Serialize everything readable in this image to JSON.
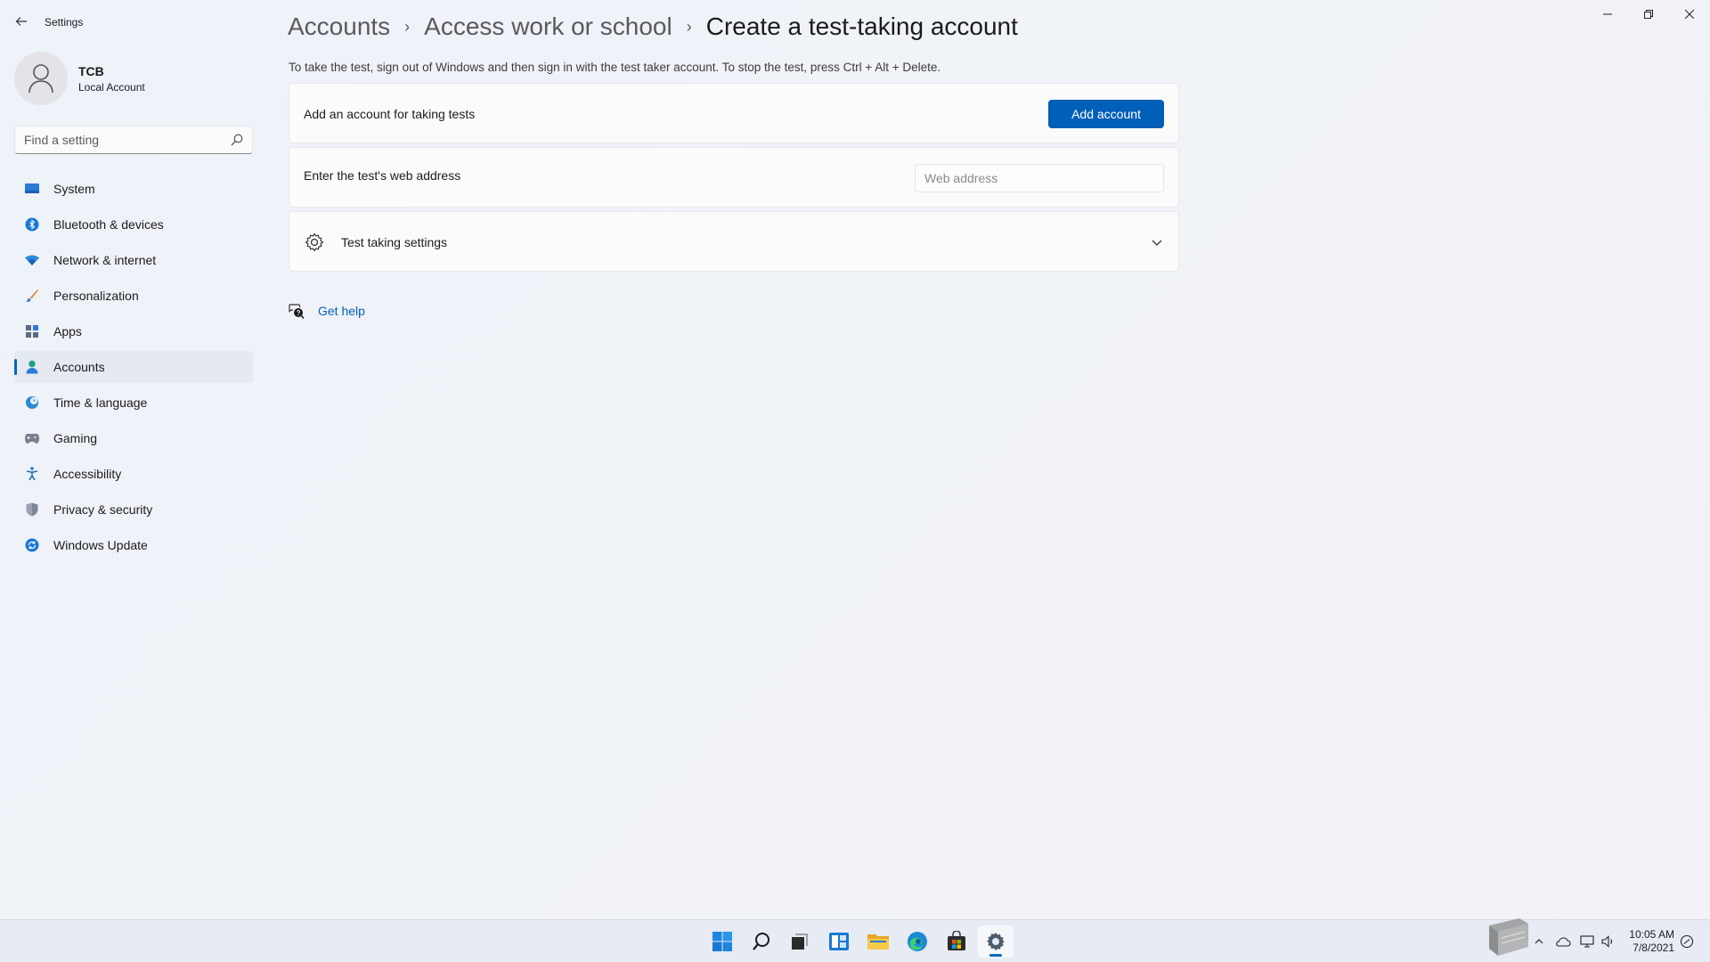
{
  "app": {
    "title": "Settings",
    "window_controls": {
      "minimize": "—",
      "maximize": "❐",
      "close": "✕"
    }
  },
  "profile": {
    "name": "TCB",
    "account_type": "Local Account"
  },
  "search": {
    "placeholder": "Find a setting"
  },
  "sidebar": {
    "items": [
      {
        "label": "System",
        "icon": "monitor-icon"
      },
      {
        "label": "Bluetooth & devices",
        "icon": "bluetooth-icon"
      },
      {
        "label": "Network & internet",
        "icon": "wifi-icon"
      },
      {
        "label": "Personalization",
        "icon": "brush-icon"
      },
      {
        "label": "Apps",
        "icon": "apps-icon"
      },
      {
        "label": "Accounts",
        "icon": "person-icon",
        "active": true
      },
      {
        "label": "Time & language",
        "icon": "globe-clock-icon"
      },
      {
        "label": "Gaming",
        "icon": "gamepad-icon"
      },
      {
        "label": "Accessibility",
        "icon": "accessibility-icon"
      },
      {
        "label": "Privacy & security",
        "icon": "shield-icon"
      },
      {
        "label": "Windows Update",
        "icon": "update-icon"
      }
    ]
  },
  "breadcrumb": {
    "items": [
      "Accounts",
      "Access work or school"
    ],
    "current": "Create a test-taking account",
    "separator": "›"
  },
  "main": {
    "description": "To take the test, sign out of Windows and then sign in with the test taker account. To stop the test, press Ctrl + Alt + Delete.",
    "add_account_card": {
      "label": "Add an account for taking tests",
      "button_label": "Add account"
    },
    "web_address_card": {
      "label": "Enter the test's web address",
      "input_placeholder": "Web address",
      "input_value": ""
    },
    "settings_card": {
      "label": "Test taking settings",
      "icon": "gear-icon",
      "expanded": false
    },
    "help": {
      "label": "Get help",
      "icon": "help-chat-icon"
    }
  },
  "taskbar": {
    "apps": [
      {
        "name": "start-icon"
      },
      {
        "name": "search-icon"
      },
      {
        "name": "task-view-icon"
      },
      {
        "name": "widgets-icon"
      },
      {
        "name": "file-explorer-icon"
      },
      {
        "name": "edge-icon"
      },
      {
        "name": "store-icon"
      },
      {
        "name": "settings-icon",
        "active": true
      }
    ],
    "clock": {
      "time": "10:05 AM",
      "date": "7/8/2021"
    }
  },
  "colors": {
    "accent": "#005fb8",
    "background": "#eef2f8",
    "card": "#fbfbfc"
  }
}
